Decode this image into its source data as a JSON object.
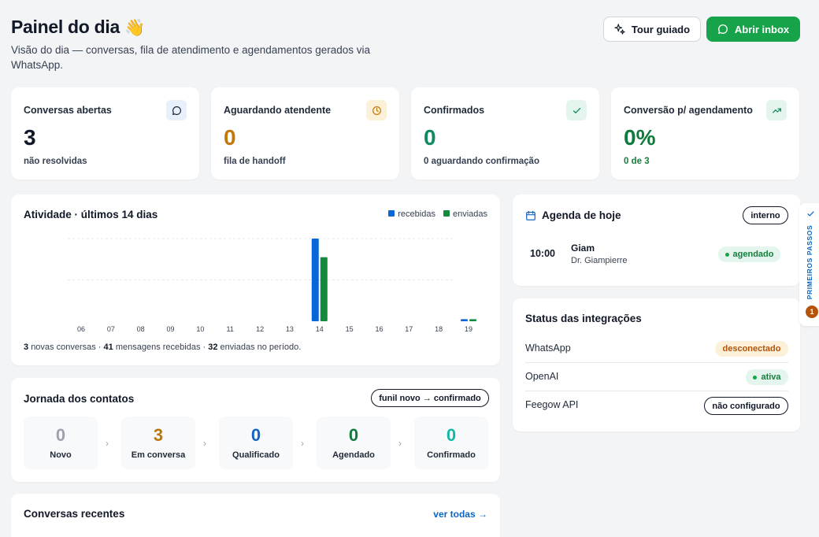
{
  "header": {
    "title": "Painel do dia",
    "emoji": "👋",
    "subtitle": "Visão do dia — conversas, fila de atendimento e agendamentos gerados via WhatsApp.",
    "tour_label": "Tour guiado",
    "inbox_label": "Abrir inbox"
  },
  "stats": [
    {
      "label": "Conversas abertas",
      "value": "3",
      "sub": "não resolvidas",
      "icon": "chat-bubble-icon",
      "color": "#111827",
      "sub_color": "#374151",
      "icon_bg": "#e8f0fb",
      "icon_color": "#1f2937"
    },
    {
      "label": "Aguardando atendente",
      "value": "0",
      "sub": "fila de handoff",
      "icon": "clock-icon",
      "color": "#c2790b",
      "sub_color": "#374151",
      "icon_bg": "#fdf0d8",
      "icon_color": "#c2790b"
    },
    {
      "label": "Confirmados",
      "value": "0",
      "sub": "0 aguardando confirmação",
      "icon": "check-icon",
      "color": "#0f8a5f",
      "sub_color": "#374151",
      "icon_bg": "#e3f5ec",
      "icon_color": "#0f8a5f"
    },
    {
      "label": "Conversão p/ agendamento",
      "value": "0%",
      "sub": "0 de 3",
      "icon": "trending-up-icon",
      "color": "#0f7a3c",
      "sub_color": "#15803d",
      "icon_bg": "#e3f5ec",
      "icon_color": "#0f8a5f"
    }
  ],
  "activity": {
    "title": "Atividade · últimos 14 dias",
    "footer": {
      "new_count": "3",
      "new_text": "novas conversas ·",
      "received_count": "41",
      "received_text": "mensagens recebidas ·",
      "sent_count": "32",
      "sent_text": "enviadas no período."
    }
  },
  "chart_data": {
    "type": "bar",
    "categories": [
      "06",
      "07",
      "08",
      "09",
      "10",
      "11",
      "12",
      "13",
      "14",
      "15",
      "16",
      "17",
      "18",
      "19"
    ],
    "series": [
      {
        "name": "recebidas",
        "color": "#0a66d8",
        "values": [
          0,
          0,
          0,
          0,
          0,
          0,
          0,
          0,
          40,
          0,
          0,
          0,
          0,
          1
        ]
      },
      {
        "name": "enviadas",
        "color": "#138a3e",
        "values": [
          0,
          0,
          0,
          0,
          0,
          0,
          0,
          0,
          31,
          0,
          0,
          0,
          0,
          1
        ]
      }
    ],
    "ylim": [
      0,
      40
    ],
    "grid": true,
    "legend": "top-right"
  },
  "journey": {
    "title": "Jornada dos contatos",
    "pill": "funil novo → confirmado",
    "stages": [
      {
        "value": "0",
        "label": "Novo",
        "color": "#9ca3af"
      },
      {
        "value": "3",
        "label": "Em conversa",
        "color": "#b7790f"
      },
      {
        "value": "0",
        "label": "Qualificado",
        "color": "#1565c0"
      },
      {
        "value": "0",
        "label": "Agendado",
        "color": "#0f7a3c"
      },
      {
        "value": "0",
        "label": "Confirmado",
        "color": "#14b8a6"
      }
    ]
  },
  "recent": {
    "title": "Conversas recentes",
    "link": "ver todas →"
  },
  "agenda": {
    "title": "Agenda de hoje",
    "pill": "interno",
    "item": {
      "time": "10:00",
      "name": "Giam",
      "doctor": "Dr. Giampierre",
      "status": "agendado"
    }
  },
  "integrations": {
    "title": "Status das integrações",
    "items": [
      {
        "name": "WhatsApp",
        "status": "desconectado",
        "kind": "warn"
      },
      {
        "name": "OpenAI",
        "status": "ativa",
        "kind": "ok"
      },
      {
        "name": "Feegow API",
        "status": "não configurado",
        "kind": "none"
      }
    ]
  },
  "side_tab": {
    "label": "PRIMEIROS PASSOS",
    "count": "1"
  }
}
